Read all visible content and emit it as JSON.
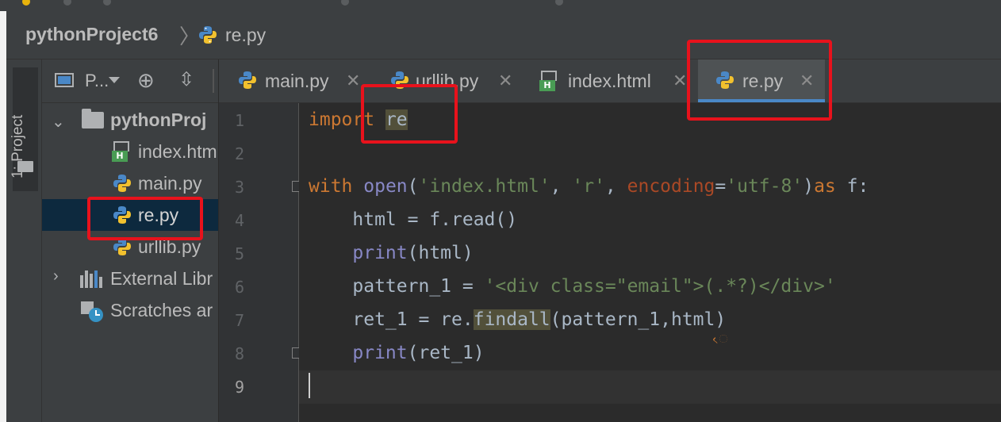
{
  "breadcrumb": {
    "project": "pythonProject6",
    "file": "re.py"
  },
  "tool_window": {
    "label": "1: Project"
  },
  "project_panel": {
    "view_label": "P..."
  },
  "tree": [
    {
      "label": "pythonProj",
      "kind": "folder",
      "expanded": true
    },
    {
      "label": "index.htm",
      "kind": "html"
    },
    {
      "label": "main.py",
      "kind": "python"
    },
    {
      "label": "re.py",
      "kind": "python",
      "selected": true
    },
    {
      "label": "urllib.py",
      "kind": "python"
    },
    {
      "label": "External Libr",
      "kind": "libraries",
      "expanded": false
    },
    {
      "label": "Scratches ar",
      "kind": "scratches"
    }
  ],
  "tabs": [
    {
      "label": "main.py",
      "icon": "python-file-icon"
    },
    {
      "label": "urllib.py",
      "icon": "python-file-icon"
    },
    {
      "label": "index.html",
      "icon": "html-file-icon"
    },
    {
      "label": "re.py",
      "icon": "python-file-icon",
      "active": true
    }
  ],
  "close_glyph": "✕",
  "line_numbers": [
    "1",
    "2",
    "3",
    "4",
    "5",
    "6",
    "7",
    "8",
    "9"
  ],
  "code": {
    "l1_kw": "import",
    "l1_mod": "re",
    "l3_with": "with",
    "l3_open": "open",
    "l3_s1": "'index.html'",
    "l3_c1": ", ",
    "l3_s2": "'r'",
    "l3_c2": ", ",
    "l3_param": "encoding",
    "l3_eq": "=",
    "l3_s3": "'utf-8'",
    "l3_close": ")",
    "l3_as": "as",
    "l3_f": " f:",
    "l4": "html = f.read()",
    "l5_fn": "print",
    "l5_rest": "(html)",
    "l6_a": "pattern_1 = ",
    "l6_s": "'<div class=\"email\">(.*?)</div>'",
    "l7_a": "ret_1 = re.",
    "l7_fn": "findall",
    "l7_b": "(pattern_1,html)",
    "l8_fn": "print",
    "l8_rest": "(ret_1)"
  },
  "colors": {
    "accent": "#4a88c7",
    "annotation": "#e8121c",
    "selection": "#0d293e"
  }
}
